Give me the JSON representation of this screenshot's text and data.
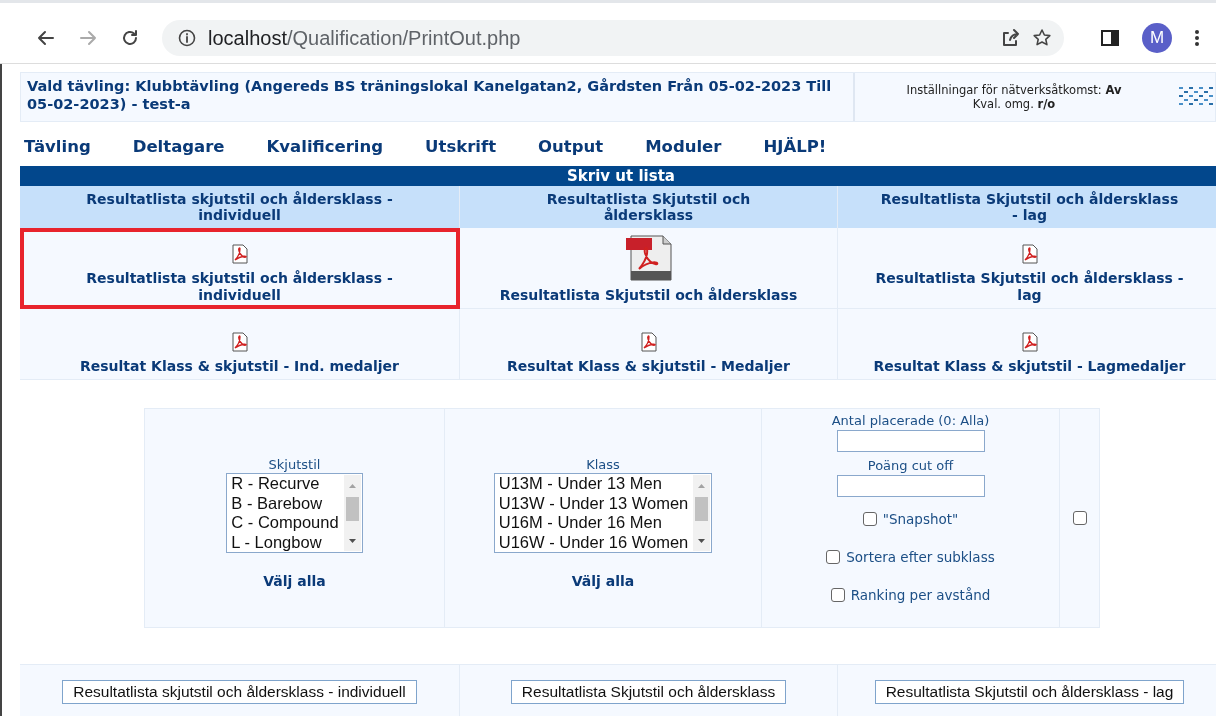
{
  "browser": {
    "url_host": "localhost",
    "url_path": "/Qualification/PrintOut.php",
    "profile_initial": "M"
  },
  "header": {
    "competition": "Vald tävling: Klubbtävling (Angereds BS träningslokal Kanelgatan2, Gårdsten Från 05-02-2023 Till 05-02-2023) - test-a",
    "network_label": "Inställningar för nätverksåtkomst:",
    "network_value": "Av",
    "qual_label": "Kval. omg.",
    "qual_value": "r/o"
  },
  "menu": [
    "Tävling",
    "Deltagare",
    "Kvalificering",
    "Utskrift",
    "Output",
    "Moduler",
    "HJÄLP!"
  ],
  "print_list": {
    "title": "Skriv ut lista",
    "headers": [
      "Resultatlista skjutstil och åldersklass - individuell",
      "Resultatlista Skjutstil och åldersklass",
      "Resultatlista Skjutstil och åldersklass - lag"
    ],
    "rows": [
      [
        {
          "label": "Resultatlista skjutstil och åldersklass - individuell",
          "kind": "small",
          "highlighted": true
        },
        {
          "label": "Resultatlista Skjutstil och åldersklass",
          "kind": "large",
          "highlighted": false
        },
        {
          "label": "Resultatlista Skjutstil och åldersklass - lag",
          "kind": "small",
          "highlighted": false
        }
      ],
      [
        {
          "label": "Resultat Klass & skjutstil - Ind. medaljer",
          "kind": "small",
          "highlighted": false
        },
        {
          "label": "Resultat Klass & skjutstil - Medaljer",
          "kind": "small",
          "highlighted": false
        },
        {
          "label": "Resultat Klass & skjutstil - Lagmedaljer",
          "kind": "small",
          "highlighted": false
        }
      ]
    ]
  },
  "options": {
    "lists": [
      {
        "label": "Skjutstil",
        "options": [
          "R - Recurve",
          "B - Barebow",
          "C - Compound",
          "L - Longbow"
        ],
        "select_all": "Välj alla"
      },
      {
        "label": "Klass",
        "options": [
          "U13M - Under 13 Men",
          "U13W - Under 13 Women",
          "U16M - Under 16 Men",
          "U16W - Under 16 Women"
        ],
        "select_all": "Välj alla"
      }
    ],
    "fields": [
      {
        "label": "Antal placerade (0: Alla)"
      },
      {
        "label": "Poäng cut off"
      }
    ],
    "checks": [
      {
        "label": "\"Snapshot\"",
        "checked": false
      },
      {
        "label": "Sortera efter subklass",
        "checked": false
      },
      {
        "label": "Ranking per avstånd",
        "checked": false
      }
    ],
    "extra_checkbox": {
      "checked": false
    }
  },
  "buttons": [
    "Resultatlista skjutstil och åldersklass - individuell",
    "Resultatlista Skjutstil och åldersklass",
    "Resultatlista Skjutstil och åldersklass - lag"
  ]
}
